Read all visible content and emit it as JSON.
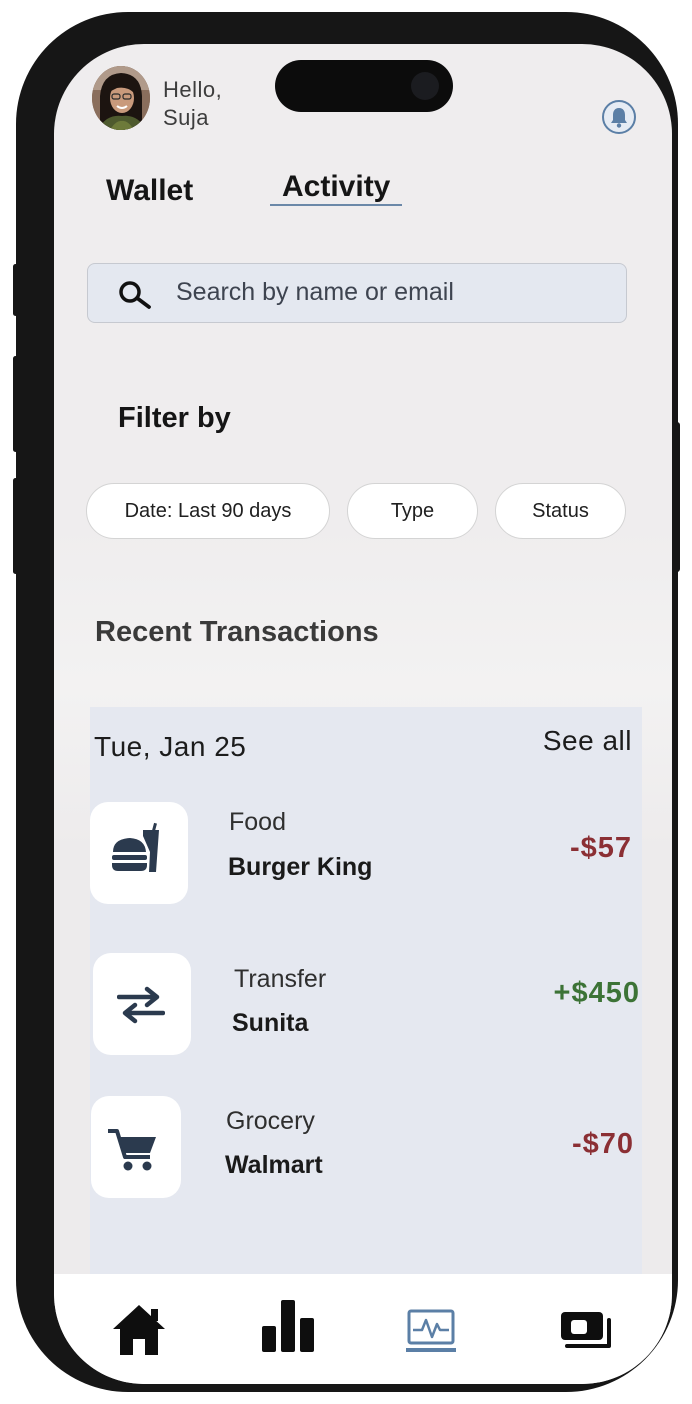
{
  "header": {
    "greeting": "Hello,",
    "user_name": "Suja"
  },
  "tabs": [
    {
      "label": "Wallet",
      "active": false
    },
    {
      "label": "Activity",
      "active": true
    }
  ],
  "search": {
    "placeholder": "Search by name or email"
  },
  "filters": {
    "title": "Filter by",
    "chips": [
      {
        "label": "Date: Last 90 days"
      },
      {
        "label": "Type"
      },
      {
        "label": "Status"
      }
    ]
  },
  "transactions": {
    "title": "Recent Transactions",
    "date": "Tue, Jan 25",
    "see_all": "See all",
    "items": [
      {
        "type": "Food",
        "name": "Burger King",
        "amount": "-$57",
        "icon": "food-icon",
        "direction": "debit"
      },
      {
        "type": "Transfer",
        "name": "Sunita",
        "amount": "+$450",
        "icon": "transfer-icon",
        "direction": "credit"
      },
      {
        "type": "Grocery",
        "name": "Walmart",
        "amount": "-$70",
        "icon": "cart-icon",
        "direction": "debit"
      }
    ]
  },
  "bottom_nav": [
    {
      "icon": "home-icon",
      "active": false
    },
    {
      "icon": "bar-chart-icon",
      "active": false
    },
    {
      "icon": "activity-icon",
      "active": true
    },
    {
      "icon": "wallet-cards-icon",
      "active": false
    }
  ],
  "colors": {
    "debit": "#8b2f34",
    "credit": "#3c7336",
    "accent": "#5b7fa6",
    "icon_dark": "#2b3a4e"
  }
}
